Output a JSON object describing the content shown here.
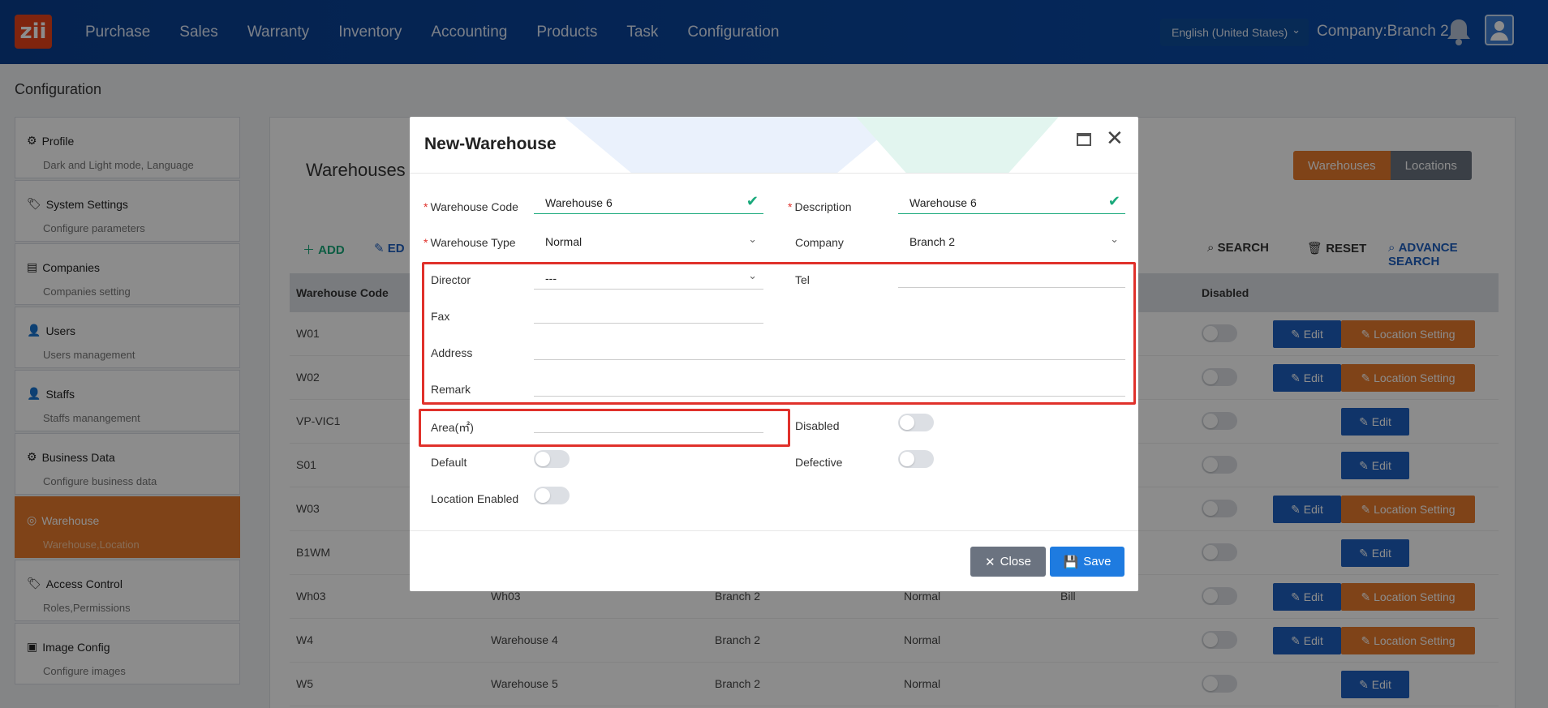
{
  "header": {
    "logo_text": "zii",
    "nav": [
      "Purchase",
      "Sales",
      "Warranty",
      "Inventory",
      "Accounting",
      "Products",
      "Task",
      "Configuration"
    ],
    "language": "English (United States)",
    "company": "Company:Branch 2"
  },
  "page": {
    "title": "Configuration"
  },
  "sidebar": {
    "items": [
      {
        "title": "Profile",
        "subtitle": "Dark and Light mode, Language"
      },
      {
        "title": "System Settings",
        "subtitle": "Configure parameters"
      },
      {
        "title": "Companies",
        "subtitle": "Companies setting"
      },
      {
        "title": "Users",
        "subtitle": "Users management"
      },
      {
        "title": "Staffs",
        "subtitle": "Staffs manangement"
      },
      {
        "title": "Business Data",
        "subtitle": "Configure business data"
      },
      {
        "title": "Warehouse",
        "subtitle": "Warehouse,Location"
      },
      {
        "title": "Access Control",
        "subtitle": "Roles,Permissions"
      },
      {
        "title": "Image Config",
        "subtitle": "Configure images"
      }
    ]
  },
  "main": {
    "title": "Warehouses",
    "tabs": {
      "warehouses": "Warehouses",
      "locations": "Locations"
    },
    "toolbar": {
      "add": "ADD",
      "edit": "ED",
      "search": "SEARCH",
      "reset": "RESET",
      "advance": "ADVANCE SEARCH"
    },
    "columns": {
      "code": "Warehouse Code",
      "disabled": "Disabled"
    },
    "rows": [
      {
        "code": "W01",
        "desc": "",
        "company": "",
        "type": "",
        "director": "",
        "location": true
      },
      {
        "code": "W02",
        "desc": "",
        "company": "",
        "type": "",
        "director": "",
        "location": true
      },
      {
        "code": "VP-VIC1",
        "desc": "",
        "company": "",
        "type": "",
        "director": "",
        "location": false
      },
      {
        "code": "S01",
        "desc": "",
        "company": "",
        "type": "",
        "director": "",
        "location": false
      },
      {
        "code": "W03",
        "desc": "",
        "company": "",
        "type": "",
        "director": "",
        "location": true
      },
      {
        "code": "B1WM",
        "desc": "",
        "company": "",
        "type": "",
        "director": "",
        "location": false
      },
      {
        "code": "Wh03",
        "desc": "Wh03",
        "company": "Branch 2",
        "type": "Normal",
        "director": "Bill",
        "location": true
      },
      {
        "code": "W4",
        "desc": "Warehouse 4",
        "company": "Branch 2",
        "type": "Normal",
        "director": "",
        "location": true
      },
      {
        "code": "W5",
        "desc": "Warehouse 5",
        "company": "Branch 2",
        "type": "Normal",
        "director": "",
        "location": false
      }
    ],
    "edit_label": "Edit",
    "location_label": "Location Setting"
  },
  "modal": {
    "title": "New-Warehouse",
    "fields": {
      "warehouse_code_label": "Warehouse Code",
      "warehouse_code_value": "Warehouse 6",
      "description_label": "Description",
      "description_value": "Warehouse 6",
      "warehouse_type_label": "Warehouse Type",
      "warehouse_type_value": "Normal",
      "company_label": "Company",
      "company_value": "Branch 2",
      "director_label": "Director",
      "director_value": "---",
      "tel_label": "Tel",
      "fax_label": "Fax",
      "address_label": "Address",
      "remark_label": "Remark",
      "area_label": "Area(㎡)",
      "disabled_label": "Disabled",
      "default_label": "Default",
      "defective_label": "Defective",
      "location_enabled_label": "Location Enabled"
    },
    "buttons": {
      "close": "Close",
      "save": "Save"
    }
  }
}
